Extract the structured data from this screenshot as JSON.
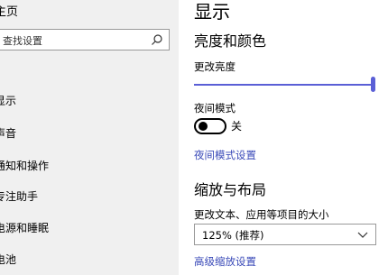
{
  "sidebar": {
    "home_label": "主页",
    "search": {
      "placeholder": "查找设置"
    },
    "items": [
      {
        "label": "显示"
      },
      {
        "label": "声音"
      },
      {
        "label": "通知和操作"
      },
      {
        "label": "专注助手"
      },
      {
        "label": "电源和睡眠"
      },
      {
        "label": "电池"
      }
    ]
  },
  "main": {
    "page_title": "显示",
    "brightness_section": {
      "title": "亮度和颜色",
      "brightness_label": "更改亮度",
      "brightness_value": 1.0,
      "night_light_label": "夜间模式",
      "night_light_state": "关",
      "night_light_link": "夜间模式设置"
    },
    "scale_section": {
      "title": "缩放与布局",
      "scale_label": "更改文本、应用等项目的大小",
      "scale_selected": "125% (推荐)",
      "advanced_link": "高级缩放设置"
    }
  },
  "colors": {
    "accent": "#5a5fd6",
    "link": "#3a4ab8",
    "sidebar_bg": "#f0f0f0"
  },
  "icons": [
    "search-icon",
    "chevron-down-icon"
  ]
}
